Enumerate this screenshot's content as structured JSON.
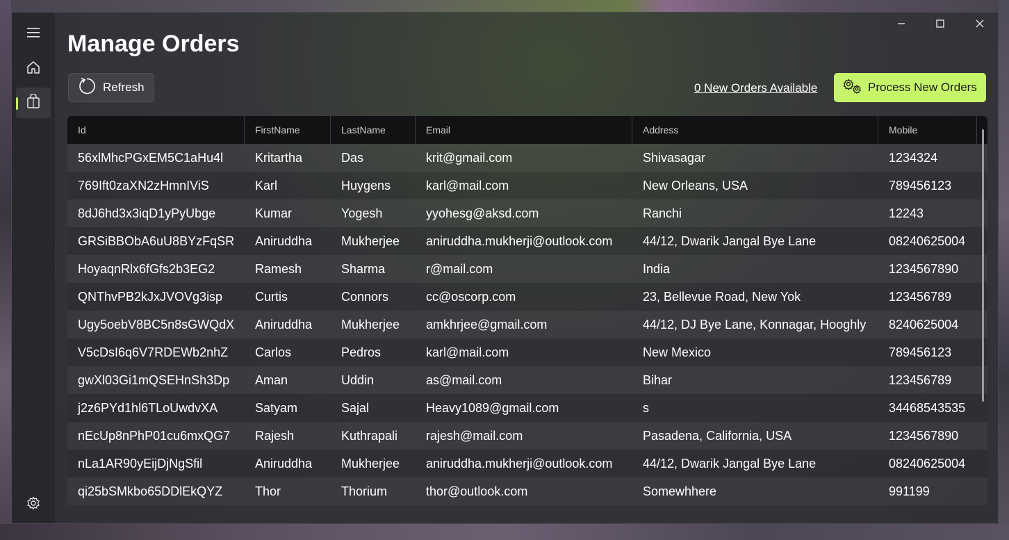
{
  "page": {
    "title": "Manage Orders"
  },
  "toolbar": {
    "refresh_label": "Refresh",
    "new_orders_link": "0 New Orders Available",
    "process_label": "Process New Orders"
  },
  "accent_color": "#c6f56a",
  "nav": {
    "items": [
      {
        "icon": "hamburger-menu-icon"
      },
      {
        "icon": "home-icon"
      },
      {
        "icon": "shopping-bag-icon",
        "active": true
      },
      {
        "icon": "gear-icon"
      }
    ]
  },
  "table": {
    "columns": [
      "Id",
      "FirstName",
      "LastName",
      "Email",
      "Address",
      "Mobile"
    ],
    "rows": [
      [
        "56xlMhcPGxEM5C1aHu4l",
        "Kritartha",
        "Das",
        "krit@gmail.com",
        "Shivasagar",
        "1234324"
      ],
      [
        "769Ift0zaXN2zHmnIViS",
        "Karl",
        "Huygens",
        "karl@mail.com",
        "New Orleans, USA",
        "789456123"
      ],
      [
        "8dJ6hd3x3iqD1yPyUbge",
        "Kumar",
        "Yogesh",
        "yyohesg@aksd.com",
        "Ranchi",
        "12243"
      ],
      [
        "GRSiBBObA6uU8BYzFqSR",
        "Aniruddha",
        "Mukherjee",
        "aniruddha.mukherji@outlook.com",
        "44/12, Dwarik Jangal Bye Lane",
        "08240625004"
      ],
      [
        "HoyaqnRlx6fGfs2b3EG2",
        "Ramesh",
        "Sharma",
        "r@mail.com",
        "India",
        "1234567890"
      ],
      [
        "QNThvPB2kJxJVOVg3isp",
        "Curtis",
        "Connors",
        "cc@oscorp.com",
        "23, Bellevue Road, New Yok",
        "123456789"
      ],
      [
        "Ugy5oebV8BC5n8sGWQdX",
        "Aniruddha",
        "Mukherjee",
        "amkhrjee@gmail.com",
        "44/12, DJ Bye Lane, Konnagar, Hooghly",
        "8240625004"
      ],
      [
        "V5cDsI6q6V7RDEWb2nhZ",
        "Carlos",
        "Pedros",
        "karl@mail.com",
        "New Mexico",
        "789456123"
      ],
      [
        "gwXl03Gi1mQSEHnSh3Dp",
        "Aman",
        "Uddin",
        "as@mail.com",
        "Bihar",
        "123456789"
      ],
      [
        "j2z6PYd1hl6TLoUwdvXA",
        "Satyam",
        "Sajal",
        "Heavy1089@gmail.com",
        "s",
        "34468543535"
      ],
      [
        "nEcUp8nPhP01cu6mxQG7",
        "Rajesh",
        "Kuthrapali",
        "rajesh@mail.com",
        "Pasadena, California, USA",
        "1234567890"
      ],
      [
        "nLa1AR90yEijDjNgSfil",
        "Aniruddha",
        "Mukherjee",
        "aniruddha.mukherji@outlook.com",
        "44/12, Dwarik Jangal Bye Lane",
        "08240625004"
      ],
      [
        "qi25bSMkbo65DDlEkQYZ",
        "Thor",
        "Thorium",
        "thor@outlook.com",
        "Somewhhere",
        "991199"
      ]
    ]
  }
}
